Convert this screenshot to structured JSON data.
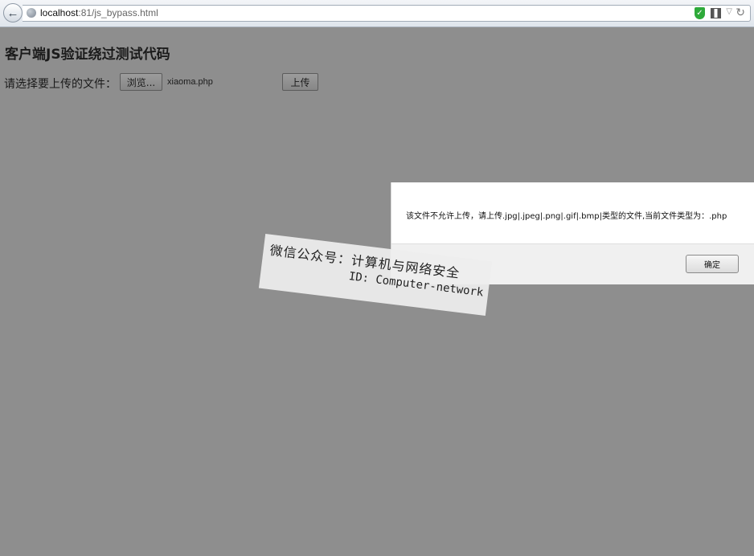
{
  "browser": {
    "url_host": "localhost",
    "url_path": ":81/js_bypass.html"
  },
  "page": {
    "title": "客户端JS验证绕过测试代码",
    "upload_label": "请选择要上传的文件：",
    "browse_label": "浏览...",
    "file_name": "xiaoma.php",
    "upload_button_label": "上传"
  },
  "dialog": {
    "message": "该文件不允许上传，请上传.jpg|.jpeg|.png|.gif|.bmp|类型的文件,当前文件类型为：.php",
    "ok_label": "确定"
  },
  "watermark": {
    "line1": "微信公众号：计算机与网络安全",
    "line2": "ID: Computer-network"
  },
  "icons": {
    "back": "back-arrow-icon",
    "globe": "globe-icon",
    "shield": "shield-icon",
    "qr": "qr-code-icon",
    "dropdown": "dropdown-icon",
    "reload": "reload-icon"
  }
}
